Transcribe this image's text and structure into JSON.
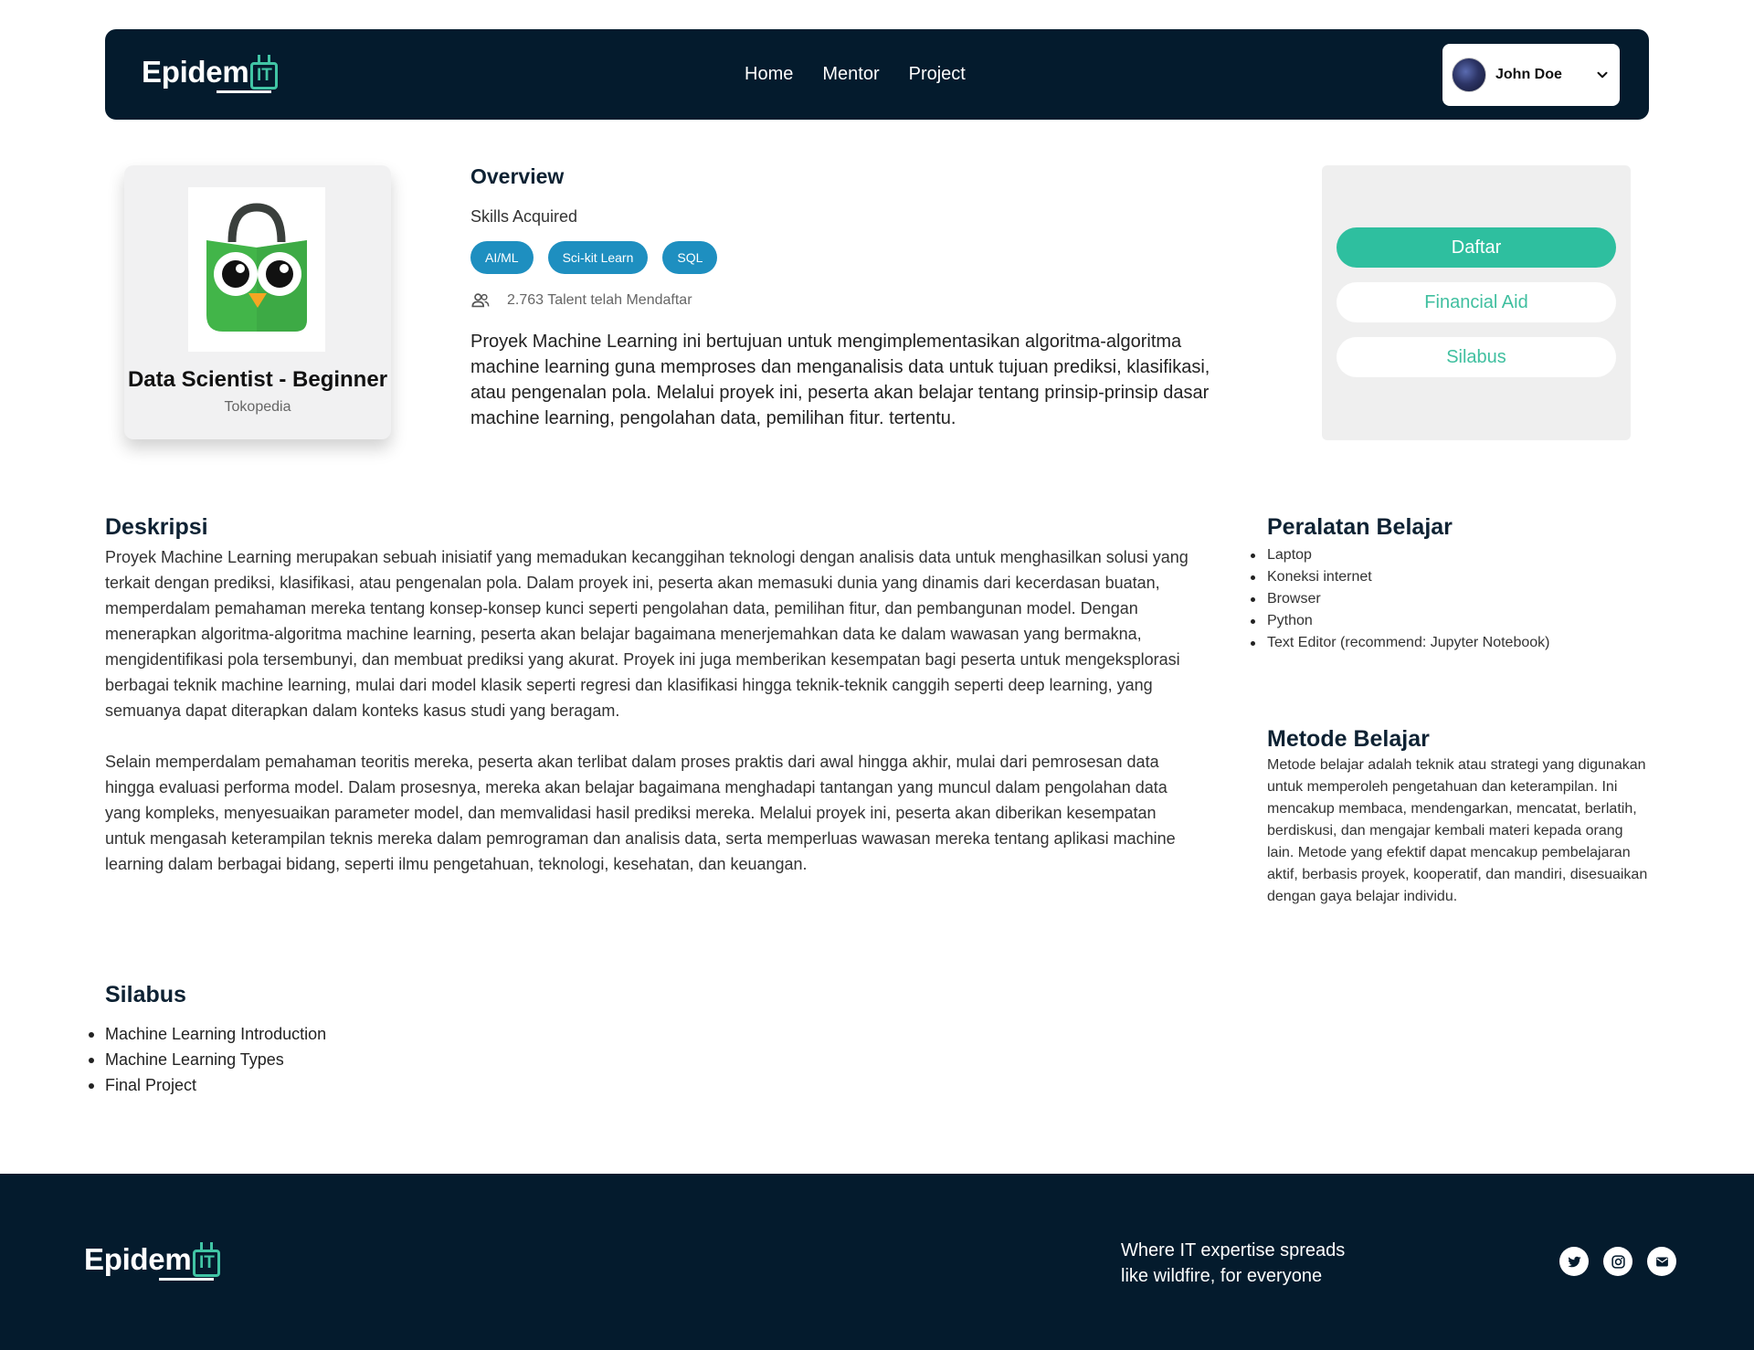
{
  "brand": {
    "logo_word": "Epidem",
    "logo_mark": "IT"
  },
  "nav": {
    "links": [
      "Home",
      "Mentor",
      "Project"
    ]
  },
  "user": {
    "name": "John Doe"
  },
  "course": {
    "title": "Data Scientist - Beginner",
    "company": "Tokopedia"
  },
  "overview": {
    "title": "Overview",
    "skills_label": "Skills Acquired",
    "skills": [
      "AI/ML",
      "Sci-kit Learn",
      "SQL"
    ],
    "talent_text": "2.763 Talent telah Mendaftar",
    "description": "Proyek Machine Learning ini bertujuan untuk mengimplementasikan algoritma-algoritma machine learning guna memproses dan menganalisis data untuk tujuan prediksi, klasifikasi, atau pengenalan pola. Melalui proyek ini, peserta akan belajar tentang prinsip-prinsip dasar machine learning, pengolahan data, pemilihan fitur. tertentu."
  },
  "actions": {
    "daftar": "Daftar",
    "financial_aid": "Financial Aid",
    "silabus": "Silabus"
  },
  "deskripsi": {
    "title": "Deskripsi",
    "paragraph1": "Proyek Machine Learning merupakan sebuah inisiatif yang memadukan kecanggihan teknologi dengan analisis data untuk menghasilkan solusi yang terkait dengan prediksi, klasifikasi, atau pengenalan pola. Dalam proyek ini, peserta akan memasuki dunia yang dinamis dari kecerdasan buatan, memperdalam pemahaman mereka tentang konsep-konsep kunci seperti pengolahan data, pemilihan fitur, dan pembangunan model. Dengan menerapkan algoritma-algoritma machine learning, peserta akan belajar bagaimana menerjemahkan data ke dalam wawasan yang bermakna, mengidentifikasi pola tersembunyi, dan membuat prediksi yang akurat. Proyek ini juga memberikan kesempatan bagi peserta untuk mengeksplorasi berbagai teknik machine learning, mulai dari model klasik seperti regresi dan klasifikasi hingga teknik-teknik canggih seperti deep learning, yang semuanya dapat diterapkan dalam konteks kasus studi yang beragam.",
    "paragraph2": "Selain memperdalam pemahaman teoritis mereka, peserta akan terlibat dalam proses praktis dari awal hingga akhir, mulai dari pemrosesan data hingga evaluasi performa model. Dalam prosesnya, mereka akan belajar bagaimana menghadapi tantangan yang muncul dalam pengolahan data yang kompleks, menyesuaikan parameter model, dan memvalidasi hasil prediksi mereka. Melalui proyek ini, peserta akan diberikan kesempatan untuk mengasah keterampilan teknis mereka dalam pemrograman dan analisis data, serta memperluas wawasan mereka tentang aplikasi machine learning dalam berbagai bidang, seperti ilmu pengetahuan, teknologi, kesehatan, dan keuangan."
  },
  "peralatan": {
    "title": "Peralatan Belajar",
    "items": [
      "Laptop",
      "Koneksi internet",
      "Browser",
      "Python",
      "Text Editor (recommend: Jupyter Notebook)"
    ]
  },
  "metode": {
    "title": "Metode Belajar",
    "text": "Metode belajar adalah teknik atau strategi yang digunakan untuk memperoleh pengetahuan dan keterampilan. Ini mencakup membaca, mendengarkan, mencatat, berlatih, berdiskusi, dan mengajar kembali materi kepada orang lain. Metode yang efektif dapat mencakup pembelajaran aktif, berbasis proyek, kooperatif, dan mandiri, disesuaikan dengan gaya belajar individu."
  },
  "silabus": {
    "title": "Silabus",
    "items": [
      "Machine Learning Introduction",
      "Machine Learning Types",
      "Final Project"
    ]
  },
  "footer": {
    "tagline_line1": "Where IT expertise spreads",
    "tagline_line2": "like wildfire, for everyone",
    "socials": [
      "twitter-icon",
      "instagram-icon",
      "mail-icon"
    ]
  },
  "colors": {
    "navy": "#041b2d",
    "accent_green": "#2ebf9f",
    "chip_blue": "#1e8fc0",
    "owl_green": "#42b549"
  }
}
